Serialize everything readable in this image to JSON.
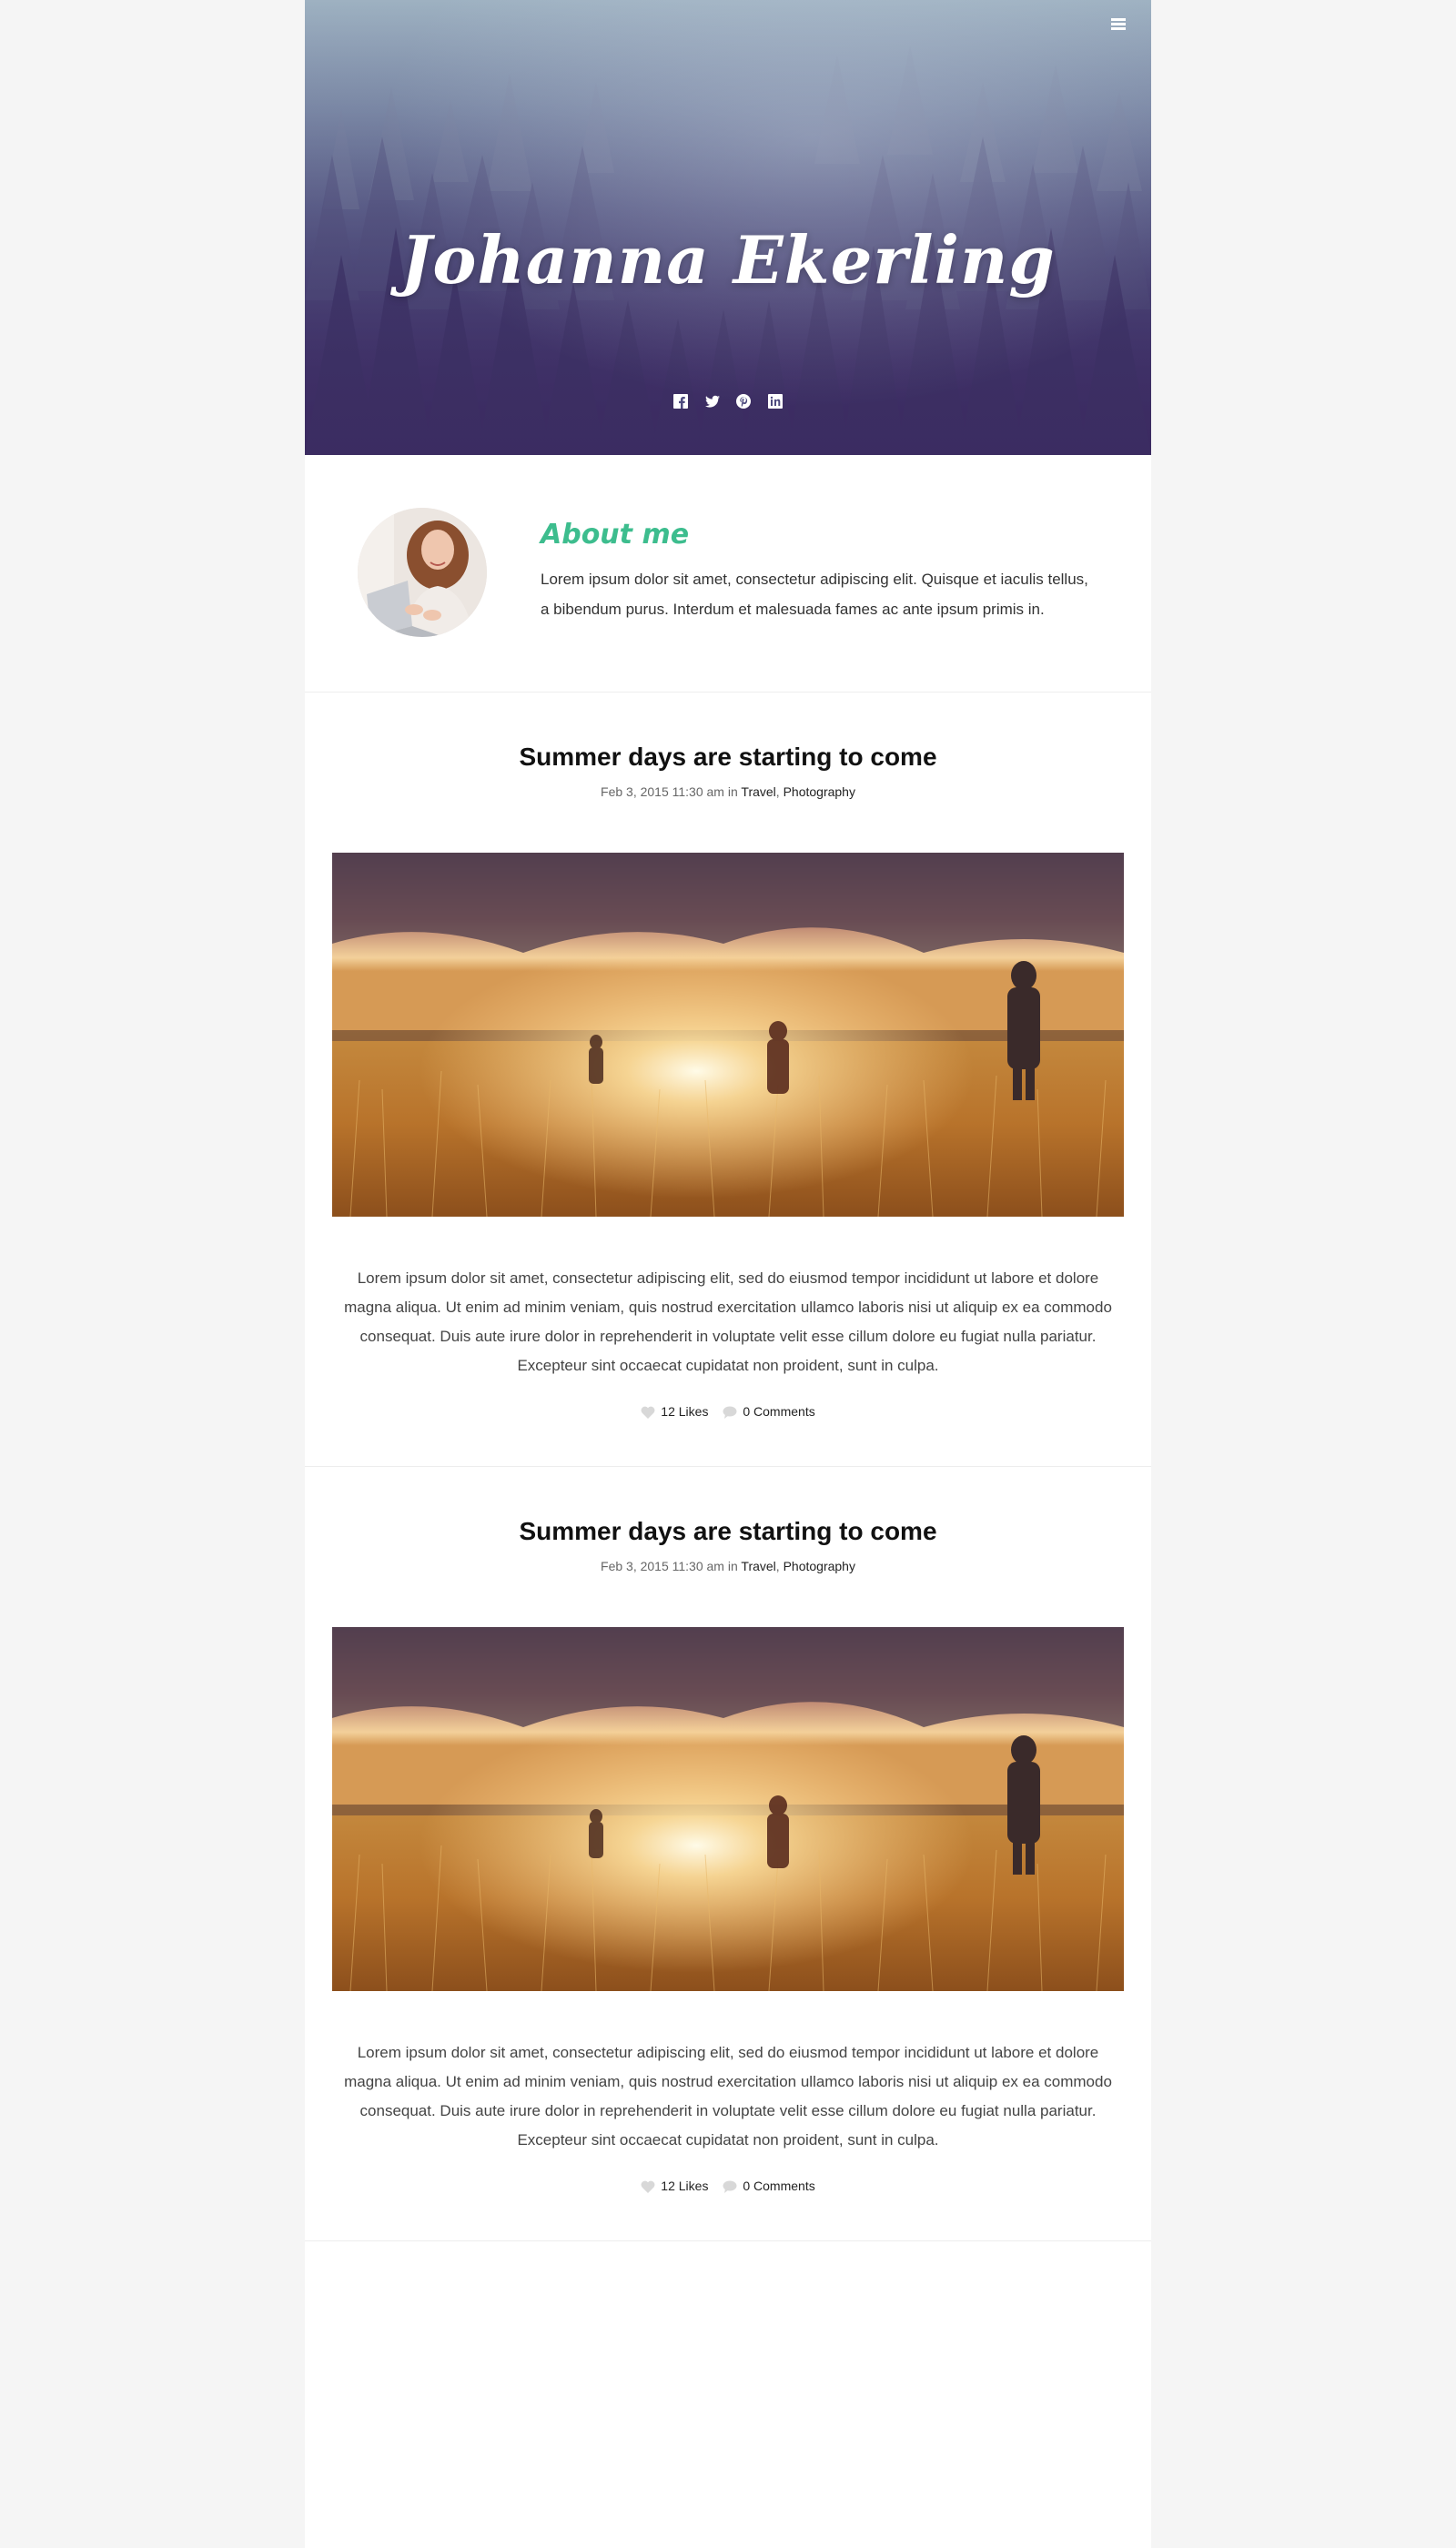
{
  "hero": {
    "site_title": "Johanna Ekerling",
    "menu_icon": "hamburger-icon",
    "social": [
      {
        "name": "facebook-icon"
      },
      {
        "name": "twitter-icon"
      },
      {
        "name": "pinterest-icon"
      },
      {
        "name": "linkedin-icon"
      }
    ]
  },
  "about": {
    "title": "About me",
    "text": "Lorem ipsum dolor sit amet, consectetur adipiscing elit. Quisque et iaculis tellus, a bibendum purus. Interdum et malesuada fames ac ante ipsum primis in."
  },
  "posts": [
    {
      "title": "Summer days are starting to come",
      "date": "Feb 3, 2015 11:30 am",
      "in_label": "in",
      "categories": [
        "Travel",
        "Photography"
      ],
      "body": "Lorem ipsum dolor sit amet, consectetur adipiscing elit, sed do eiusmod tempor incididunt ut labore et dolore magna aliqua. Ut enim ad minim veniam, quis nostrud exercitation ullamco laboris nisi ut aliquip ex ea commodo consequat. Duis aute irure dolor in reprehenderit in voluptate velit esse cillum dolore eu fugiat nulla pariatur. Excepteur sint occaecat cupidatat non proident, sunt in culpa.",
      "likes": "12 Likes",
      "comments": "0 Comments"
    },
    {
      "title": "Summer days are starting to come",
      "date": "Feb 3, 2015 11:30 am",
      "in_label": "in",
      "categories": [
        "Travel",
        "Photography"
      ],
      "body": "Lorem ipsum dolor sit amet, consectetur adipiscing elit, sed do eiusmod tempor incididunt ut labore et dolore magna aliqua. Ut enim ad minim veniam, quis nostrud exercitation ullamco laboris nisi ut aliquip ex ea commodo consequat. Duis aute irure dolor in reprehenderit in voluptate velit esse cillum dolore eu fugiat nulla pariatur. Excepteur sint occaecat cupidatat non proident, sunt in culpa.",
      "likes": "12 Likes",
      "comments": "0 Comments"
    }
  ],
  "colors": {
    "accent": "#3dbd8e",
    "page_bg": "#f5f5f5",
    "content_bg": "#ffffff"
  }
}
